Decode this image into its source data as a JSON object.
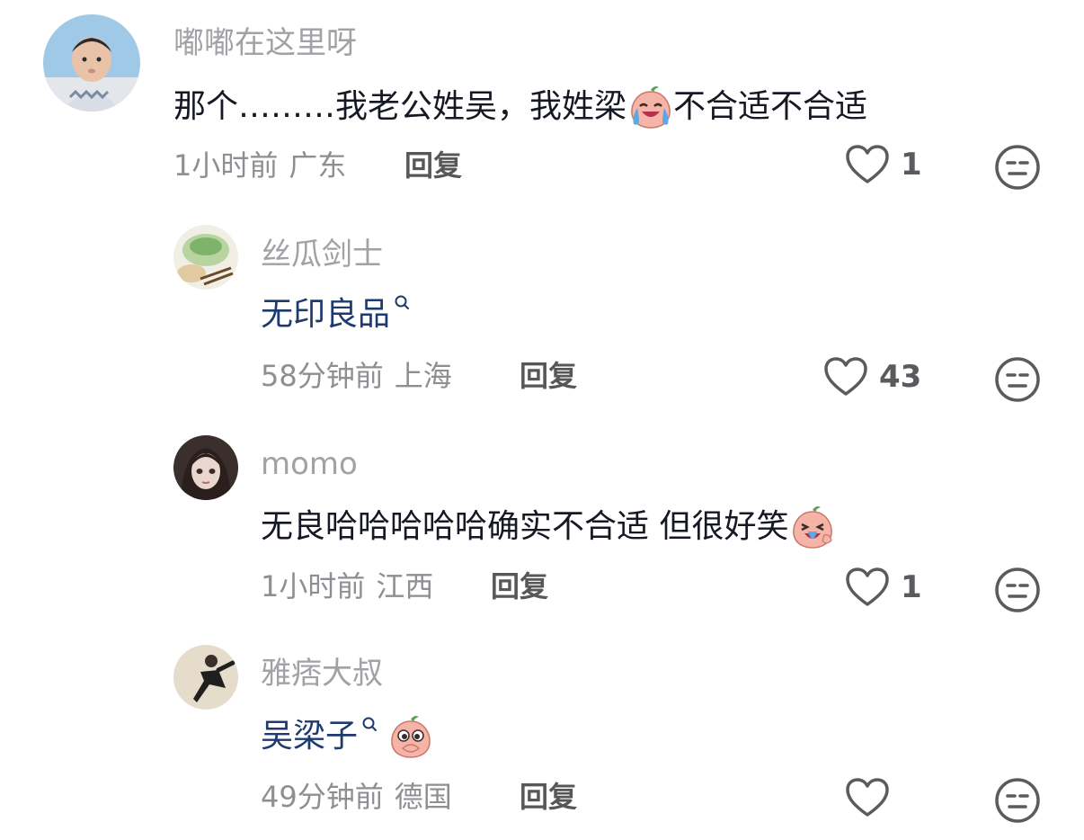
{
  "comments": [
    {
      "author": "嘟嘟在这里呀",
      "text": "那个………我老公姓吴，我姓梁",
      "text_after_emoji": "不合适不合适",
      "emoji": "crying-laughing-peach-emoji",
      "time": "1小时前",
      "location": "广东",
      "reply_label": "回复",
      "likes": "1"
    },
    {
      "author": "丝瓜剑士",
      "text": "无印良品",
      "link": true,
      "time": "58分钟前",
      "location": "上海",
      "reply_label": "回复",
      "likes": "43"
    },
    {
      "author": "momo",
      "text": "无良哈哈哈哈哈确实不合适 但很好笑",
      "emoji": "laughing-crying-peach-emoji",
      "time": "1小时前",
      "location": "江西",
      "reply_label": "回复",
      "likes": "1"
    },
    {
      "author": "雅痞大叔",
      "text": "吴梁子",
      "link": true,
      "emoji": "covering-mouth-peach-emoji",
      "time": "49分钟前",
      "location": "德国",
      "reply_label": "回复",
      "likes": ""
    }
  ],
  "icons": {
    "like": "heart-outline-icon",
    "dislike": "meh-face-icon",
    "search": "search-magnifier-icon"
  },
  "colors": {
    "link": "#1f3a6e",
    "secondary_text": "#a1a1a6",
    "primary_text": "#161823"
  }
}
